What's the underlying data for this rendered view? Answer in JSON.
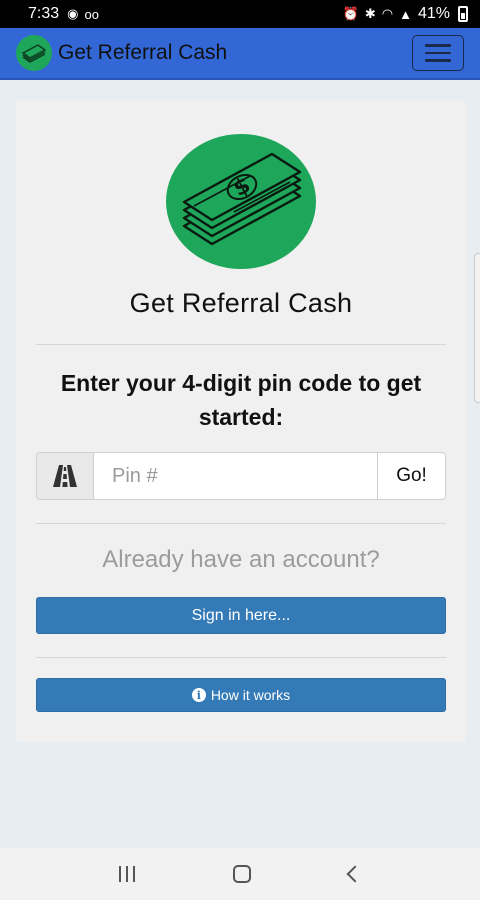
{
  "status_bar": {
    "time": "7:33",
    "battery": "41%"
  },
  "navbar": {
    "title": "Get Referral Cash",
    "menu_icon": "hamburger-icon",
    "logo_icon": "money-stack-icon"
  },
  "card": {
    "title": "Get Referral Cash",
    "prompt": "Enter your 4-digit pin code to get started:",
    "pin_placeholder": "Pin #",
    "pin_value": "",
    "addon_icon": "road-icon",
    "go_label": "Go!",
    "already_text": "Already have an account?",
    "signin_label": "Sign in here...",
    "how_label": "How it works",
    "how_icon": "info-icon"
  },
  "colors": {
    "navbar": "#3367d6",
    "brand_green": "#1ea65a",
    "button_blue": "#337ab7"
  }
}
